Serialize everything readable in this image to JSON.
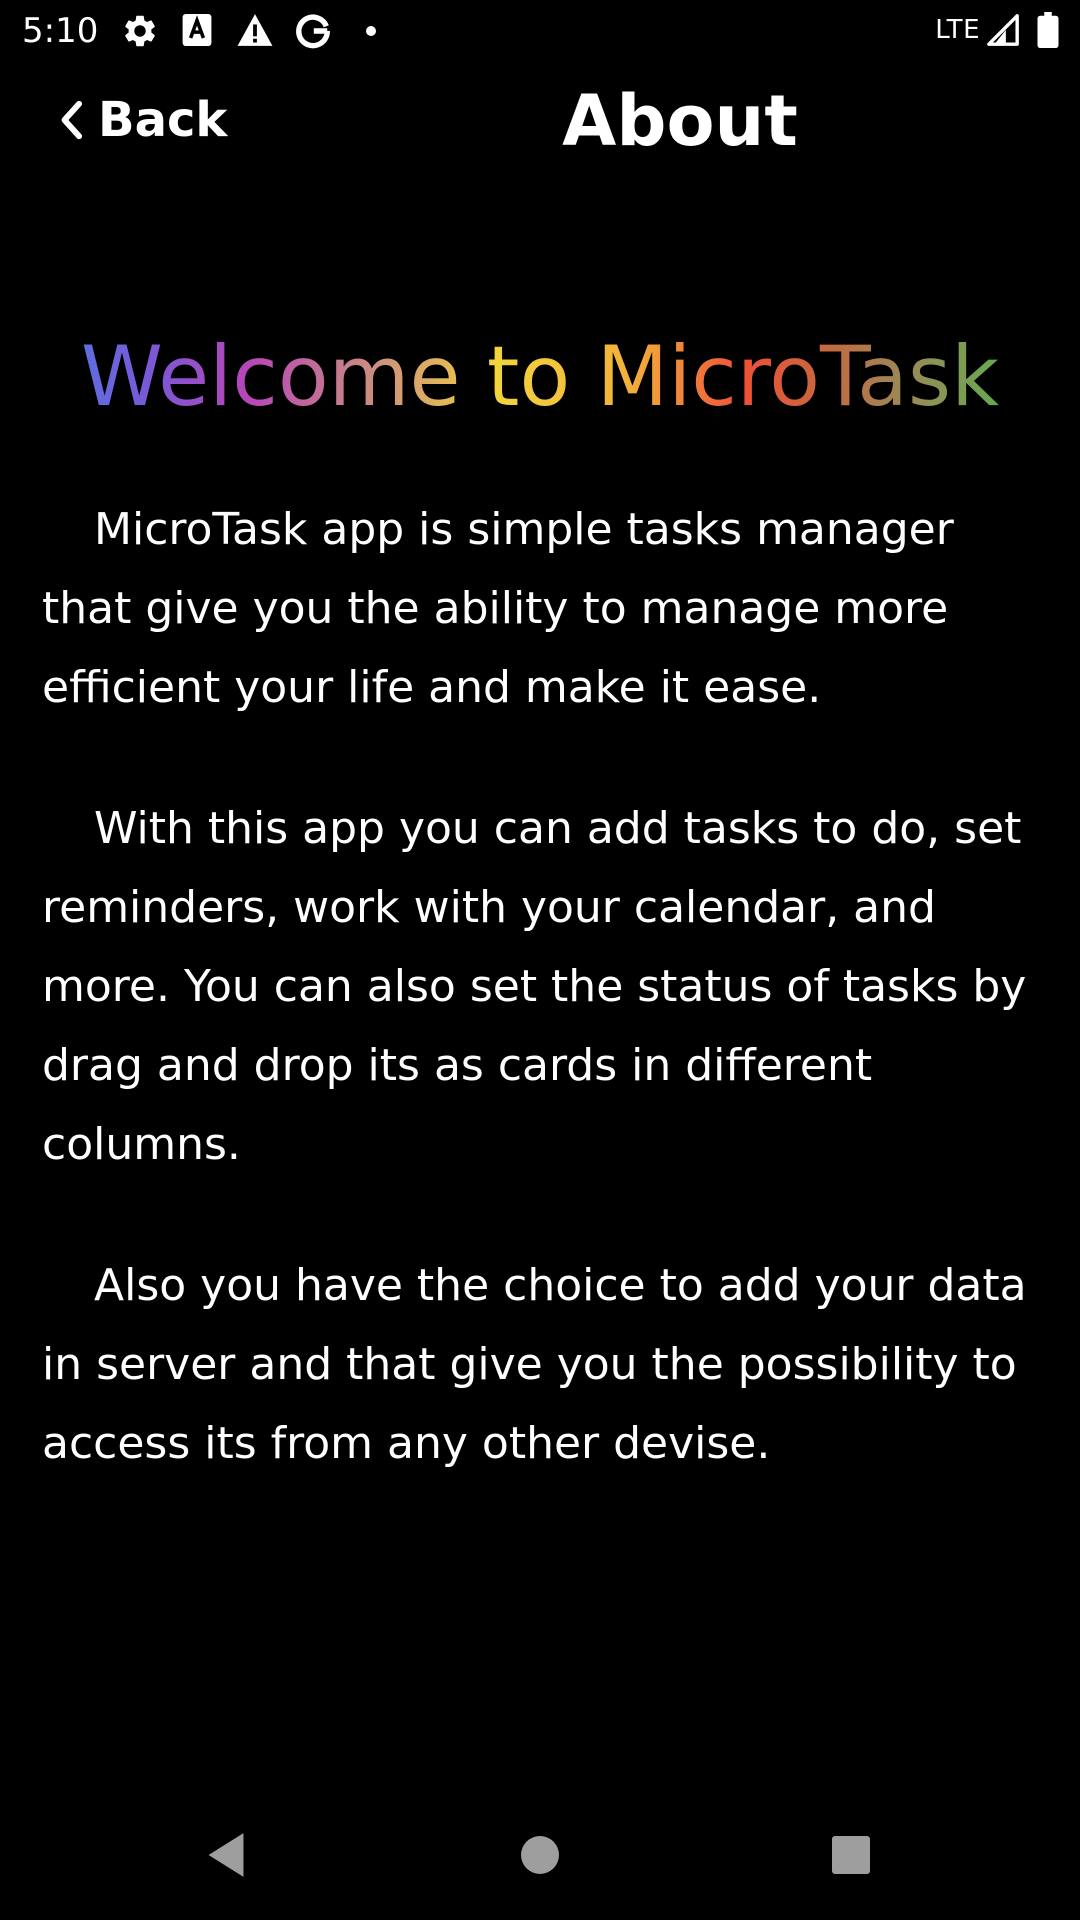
{
  "status_bar": {
    "time": "5:10",
    "icons": [
      "gear-icon",
      "text-a-icon",
      "warning-icon",
      "google-g-icon",
      "dot-icon"
    ],
    "network_label": "LTE",
    "right_icons": [
      "signal-icon",
      "battery-icon"
    ]
  },
  "toolbar": {
    "back_icon": "chevron-left-icon",
    "back_label": "Back",
    "title": "About"
  },
  "main": {
    "heading": "Welcome to MicroTask",
    "heading_gradient": [
      "#3f86e8",
      "#b746b8",
      "#f2d43c",
      "#ee5138",
      "#4caf50"
    ],
    "paragraphs": [
      "MicroTask app is simple tasks manager that give you the ability to manage more efficient your life and make it ease.",
      "With this app you can add tasks to do, set reminders, work with your calendar, and more. You can also set the status of tasks by drag and drop its as cards in different columns.",
      "Also you have the choice to add your data in server and that give you the possibility to access its from any other devise."
    ]
  },
  "nav_bar": {
    "buttons": [
      "back-triangle-icon",
      "home-circle-icon",
      "recents-square-icon"
    ],
    "icon_color": "#9e9e9e"
  },
  "colors": {
    "background": "#000000",
    "text": "#ffffff"
  }
}
